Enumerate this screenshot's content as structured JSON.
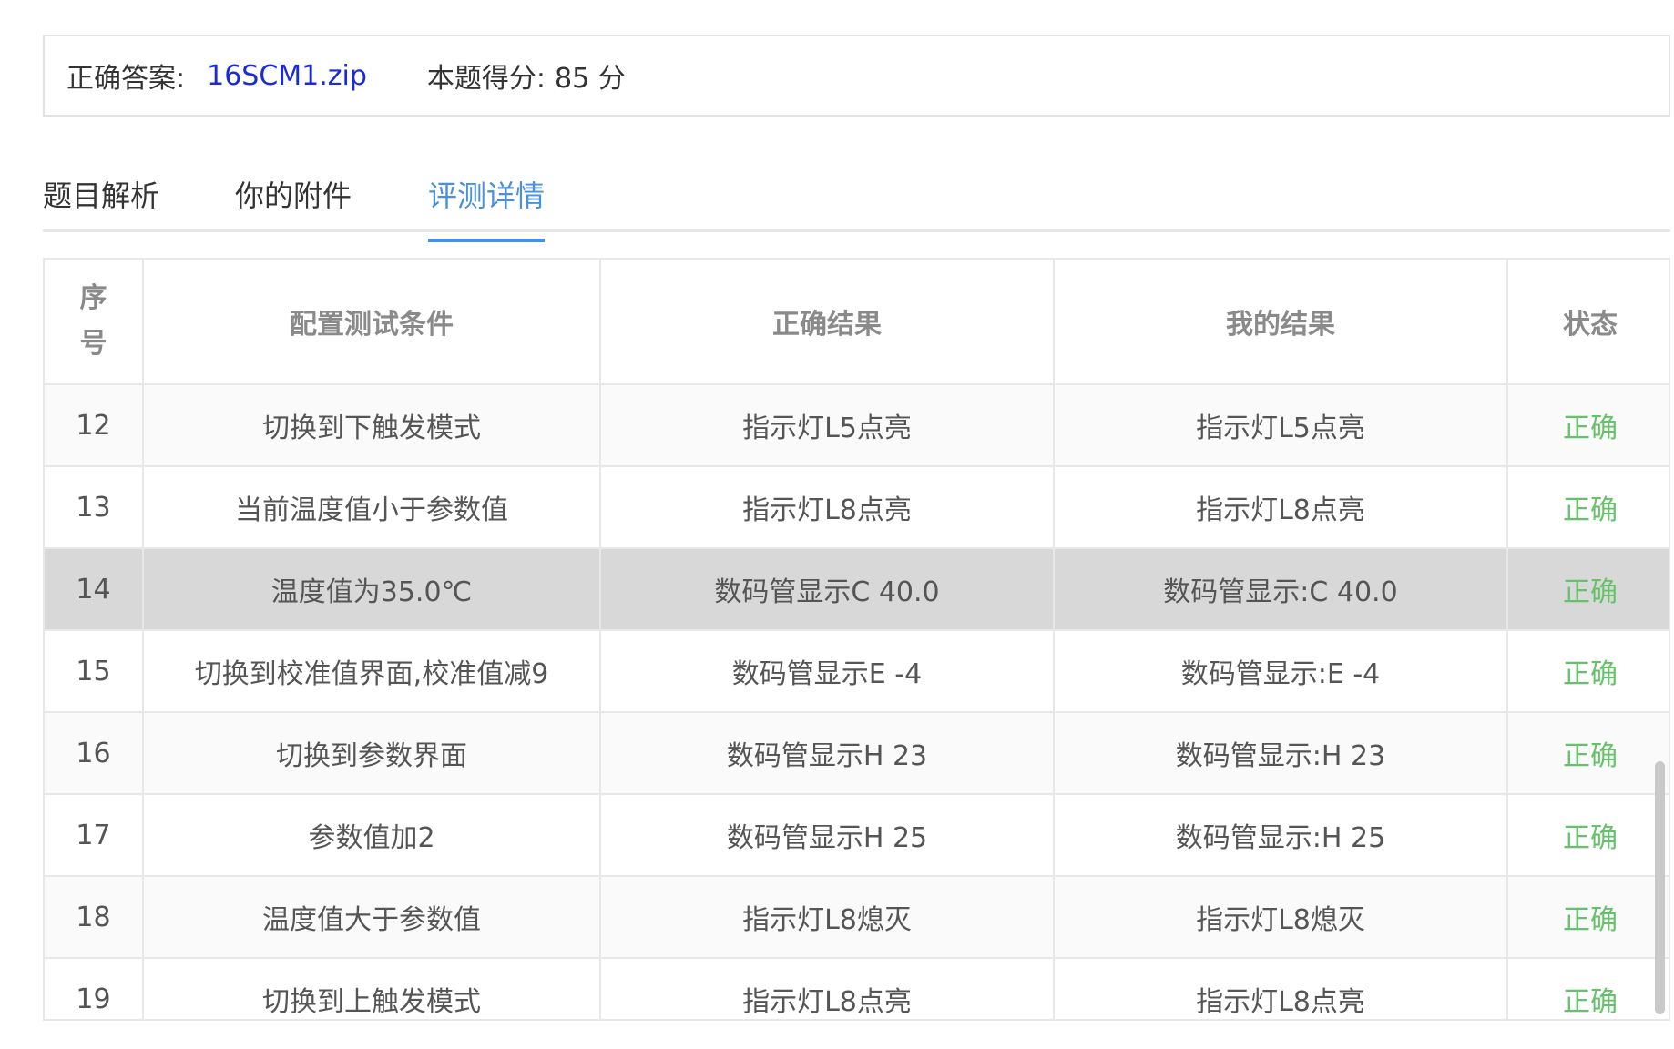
{
  "answer": {
    "label": "正确答案:",
    "file": "16SCM1.zip",
    "score_label": "本题得分:",
    "score_value": "85 分"
  },
  "tabs": [
    {
      "label": "题目解析",
      "active": false
    },
    {
      "label": "你的附件",
      "active": false
    },
    {
      "label": "评测详情",
      "active": true
    }
  ],
  "colors": {
    "active_tab": "#4a90e2",
    "link": "#1a2ad6",
    "status_ok": "#66c26a"
  },
  "table": {
    "headers": {
      "seq_line1": "序",
      "seq_line2": "号",
      "condition": "配置测试条件",
      "expected": "正确结果",
      "actual": "我的结果",
      "status": "状态"
    },
    "rows": [
      {
        "seq": "12",
        "condition": "切换到下触发模式",
        "expected": "指示灯L5点亮",
        "actual": "指示灯L5点亮",
        "status": "正确"
      },
      {
        "seq": "13",
        "condition": "当前温度值小于参数值",
        "expected": "指示灯L8点亮",
        "actual": "指示灯L8点亮",
        "status": "正确"
      },
      {
        "seq": "14",
        "condition": "温度值为35.0℃",
        "expected": "数码管显示C 40.0",
        "actual": "数码管显示:C 40.0",
        "status": "正确"
      },
      {
        "seq": "15",
        "condition": "切换到校准值界面,校准值减9",
        "expected": "数码管显示E -4",
        "actual": "数码管显示:E -4",
        "status": "正确"
      },
      {
        "seq": "16",
        "condition": "切换到参数界面",
        "expected": "数码管显示H 23",
        "actual": "数码管显示:H 23",
        "status": "正确"
      },
      {
        "seq": "17",
        "condition": "参数值加2",
        "expected": "数码管显示H 25",
        "actual": "数码管显示:H 25",
        "status": "正确"
      },
      {
        "seq": "18",
        "condition": "温度值大于参数值",
        "expected": "指示灯L8熄灭",
        "actual": "指示灯L8熄灭",
        "status": "正确"
      },
      {
        "seq": "19",
        "condition": "切换到上触发模式",
        "expected": "指示灯L8点亮",
        "actual": "指示灯L8点亮",
        "status": "正确"
      }
    ]
  }
}
